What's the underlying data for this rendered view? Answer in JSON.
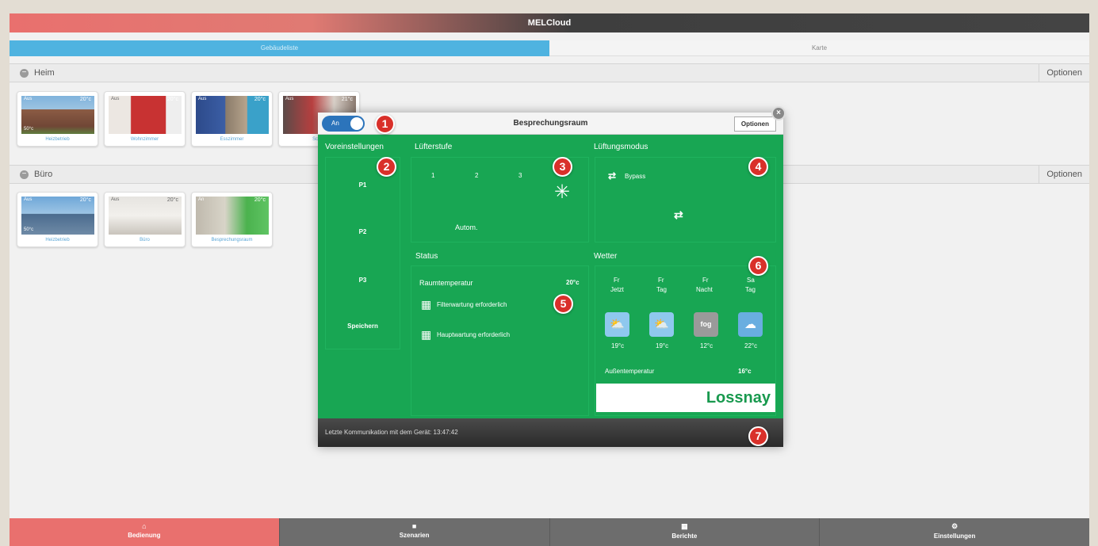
{
  "app": {
    "title": "MELCloud"
  },
  "view_tabs": [
    {
      "label": "Gebäudeliste",
      "active": true
    },
    {
      "label": "Karte",
      "active": false
    }
  ],
  "groups": [
    {
      "name": "Heim",
      "options_label": "Optionen",
      "devices": [
        {
          "name": "Heizbetrieb",
          "status": "Aus",
          "temp1": "20°c",
          "temp2": "50°c"
        },
        {
          "name": "Wohnzimmer",
          "status": "Aus",
          "temp1": "20°c",
          "temp2": ""
        },
        {
          "name": "Esszimmer",
          "status": "Aus",
          "temp1": "20°c",
          "temp2": ""
        },
        {
          "name": "Schlaf",
          "status": "Aus",
          "temp1": "21°c",
          "temp2": ""
        }
      ]
    },
    {
      "name": "Büro",
      "options_label": "Optionen",
      "devices": [
        {
          "name": "Heizbetrieb",
          "status": "Aus",
          "temp1": "20°c",
          "temp2": "50°c"
        },
        {
          "name": "Büro",
          "status": "Aus",
          "temp1": "20°c",
          "temp2": ""
        },
        {
          "name": "Besprechungsraum",
          "status": "An",
          "temp1": "20°c",
          "temp2": ""
        }
      ]
    }
  ],
  "modal": {
    "title": "Besprechungsraum",
    "power_label": "An",
    "options_label": "Optionen",
    "close_icon": "close-icon",
    "presets": {
      "label": "Voreinstellungen",
      "items": [
        "P1",
        "P2",
        "P3",
        "Speichern"
      ]
    },
    "fan": {
      "label": "Lüfterstufe",
      "levels": [
        "1",
        "2",
        "3"
      ],
      "auto_label": "Autom.",
      "icon": "fan-icon"
    },
    "vent_mode": {
      "label": "Lüftungsmodus",
      "bypass_label": "Bypass"
    },
    "status": {
      "label": "Status",
      "room_temp_label": "Raumtemperatur",
      "room_temp_value": "20°c",
      "filter_warning": "Filterwartung erforderlich",
      "main_warning": "Hauptwartung erforderlich"
    },
    "weather": {
      "label": "Wetter",
      "forecast": [
        {
          "day": "Fr",
          "period": "Jetzt",
          "icon": "partly-cloudy-rain-icon",
          "temp": "19°c"
        },
        {
          "day": "Fr",
          "period": "Tag",
          "icon": "partly-cloudy-rain-icon",
          "temp": "19°c"
        },
        {
          "day": "Fr",
          "period": "Nacht",
          "icon": "fog-icon",
          "icon_text": "fog",
          "temp": "12°c"
        },
        {
          "day": "Sa",
          "period": "Tag",
          "icon": "cloud-icon",
          "temp": "22°c"
        }
      ],
      "outdoor_label": "Außentemperatur",
      "outdoor_value": "16°c"
    },
    "brand": "Lossnay",
    "footer": "Letzte Kommunikation mit dem Gerät: 13:47:42"
  },
  "callouts": [
    "1",
    "2",
    "3",
    "4",
    "5",
    "6",
    "7"
  ],
  "bottom_nav": [
    {
      "label": "Bedienung",
      "icon": "home-icon",
      "active": true
    },
    {
      "label": "Szenarien",
      "icon": "camera-icon",
      "active": false
    },
    {
      "label": "Berichte",
      "icon": "grid-icon",
      "active": false
    },
    {
      "label": "Einstellungen",
      "icon": "gear-icon",
      "active": false
    }
  ],
  "colors": {
    "accent_red": "#e9706e",
    "tab_blue": "#4fb3e0",
    "device_green": "#18a653",
    "callout_red": "#d9302a"
  }
}
